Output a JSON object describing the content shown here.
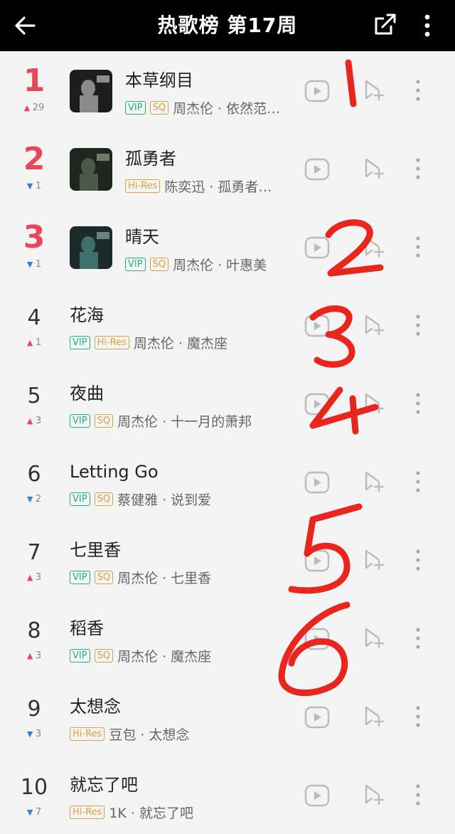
{
  "header": {
    "title": "热歌榜 第17周",
    "back_icon": "arrow-left-icon",
    "share_icon": "share-icon",
    "more_icon": "more-vertical-icon"
  },
  "colors": {
    "accent_red": "#e8465a",
    "down_blue": "#3a7bd5",
    "vip_green": "#1fb37f",
    "sq_gold": "#d6a23c",
    "annotation_red": "#e8261e"
  },
  "songs": [
    {
      "rank": "1",
      "direction": "up",
      "change": "29",
      "title": "本草纲目",
      "tags": [
        "VIP",
        "SQ"
      ],
      "artist": "周杰伦 · 依然范…",
      "cover": true
    },
    {
      "rank": "2",
      "direction": "down",
      "change": "1",
      "title": "孤勇者",
      "tags": [
        "Hi-Res"
      ],
      "artist": "陈奕迅 · 孤勇者…",
      "cover": true
    },
    {
      "rank": "3",
      "direction": "down",
      "change": "1",
      "title": "晴天",
      "tags": [
        "VIP",
        "SQ"
      ],
      "artist": "周杰伦 · 叶惠美",
      "cover": true
    },
    {
      "rank": "4",
      "direction": "up",
      "change": "1",
      "title": "花海",
      "tags": [
        "VIP",
        "Hi-Res"
      ],
      "artist": "周杰伦 · 魔杰座",
      "cover": false
    },
    {
      "rank": "5",
      "direction": "up",
      "change": "3",
      "title": "夜曲",
      "tags": [
        "VIP",
        "SQ"
      ],
      "artist": "周杰伦 · 十一月的萧邦",
      "cover": false
    },
    {
      "rank": "6",
      "direction": "down",
      "change": "2",
      "title": "Letting Go",
      "tags": [
        "VIP",
        "SQ"
      ],
      "artist": "蔡健雅 · 说到爱",
      "cover": false
    },
    {
      "rank": "7",
      "direction": "up",
      "change": "3",
      "title": "七里香",
      "tags": [
        "VIP",
        "SQ"
      ],
      "artist": "周杰伦 · 七里香",
      "cover": false
    },
    {
      "rank": "8",
      "direction": "up",
      "change": "3",
      "title": "稻香",
      "tags": [
        "VIP",
        "SQ"
      ],
      "artist": "周杰伦 · 魔杰座",
      "cover": false
    },
    {
      "rank": "9",
      "direction": "down",
      "change": "3",
      "title": "太想念",
      "tags": [
        "Hi-Res"
      ],
      "artist": "豆包 · 太想念",
      "cover": false
    },
    {
      "rank": "10",
      "direction": "down",
      "change": "7",
      "title": "就忘了吧",
      "tags": [
        "Hi-Res"
      ],
      "artist": "1K · 就忘了吧",
      "cover": false
    }
  ],
  "row_icons": {
    "play": "play-icon",
    "add": "add-to-playlist-icon",
    "more": "more-vertical-icon"
  },
  "annotations": [
    "1",
    "2",
    "3",
    "4",
    "5",
    "6"
  ]
}
